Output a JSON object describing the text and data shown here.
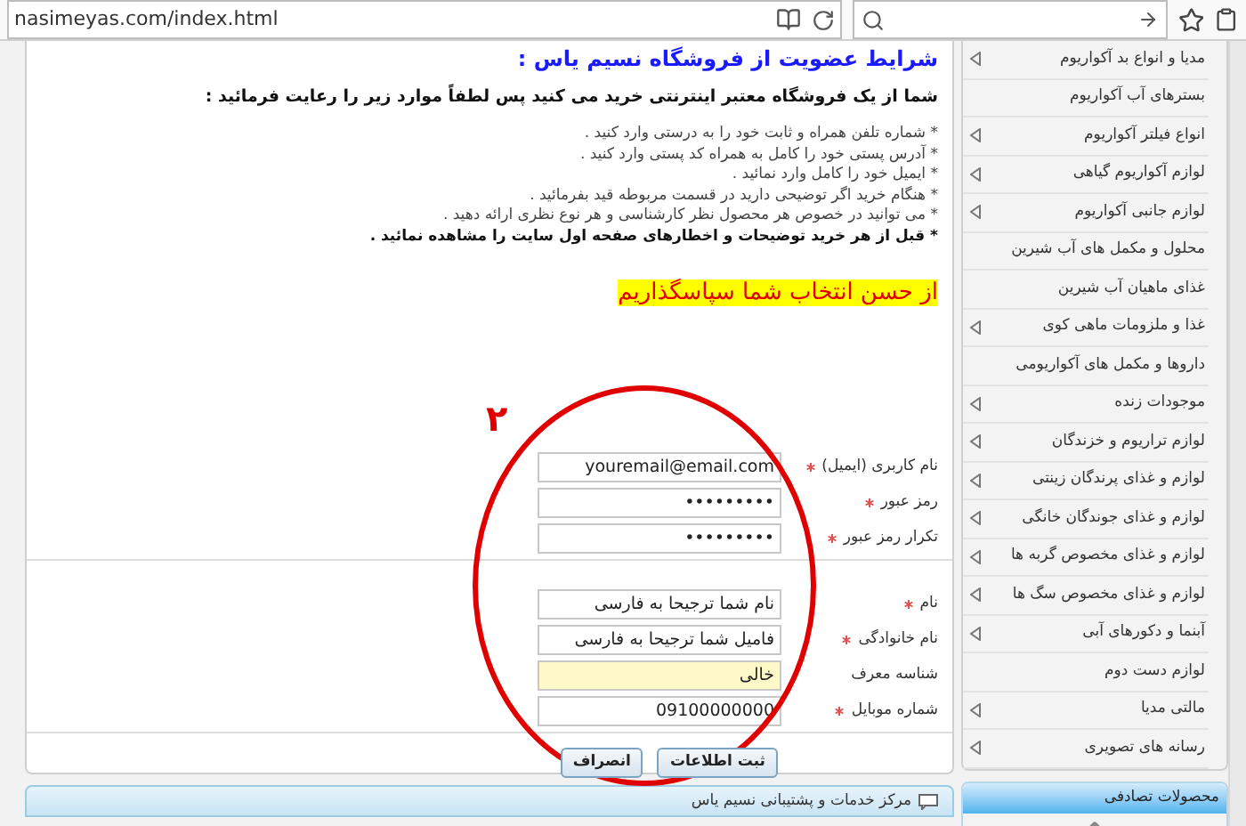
{
  "browser": {
    "url": "nasimeyas.com/index.html"
  },
  "terms": {
    "title": "شرایط عضویت از فروشگاه نسیم یاس :",
    "intro": "شما از یک فروشگاه معتبر اینترنتی خرید می کنید پس لطفاً موارد زیر را رعایت فرمائید :",
    "bullets": [
      {
        "text": "* شماره تلفن همراه و ثابت خود را به درستی وارد کنید .",
        "bold": false
      },
      {
        "text": "* آدرس پستی خود را کامل به همراه کد پستی وارد کنید .",
        "bold": false
      },
      {
        "text": "* ایمیل خود را کامل وارد نمائید .",
        "bold": false
      },
      {
        "text": "* هنگام خرید اگر توضیحی دارید در قسمت مربوطه قید بفرمائید .",
        "bold": false
      },
      {
        "text": "* می توانید در خصوص هر محصول نظر کارشناسی و هر نوع نظری ارائه دهید .",
        "bold": false
      },
      {
        "text": "* قبل از هر خرید توضیحات و اخطارهای صفحه اول سایت را مشاهده نمائید .",
        "bold": true
      }
    ],
    "thanks": "از حسن انتخاب شما سپاسگذاریم"
  },
  "annotation": {
    "marker": "۲"
  },
  "form_groups": [
    {
      "fields": [
        {
          "label": "نام کاربری (ایمیل)",
          "required": true,
          "value": "youremail@email.com",
          "highlighted": false
        },
        {
          "label": "رمز عبور",
          "required": true,
          "value": "•••••••••",
          "highlighted": false
        },
        {
          "label": "تکرار رمز عبور",
          "required": true,
          "value": "•••••••••",
          "highlighted": false
        }
      ]
    },
    {
      "fields": [
        {
          "label": "نام",
          "required": true,
          "value": "نام شما ترجیحا به فارسی",
          "highlighted": false
        },
        {
          "label": "نام خانوادگی",
          "required": true,
          "value": "فامیل شما ترجیحا به فارسی",
          "highlighted": false
        },
        {
          "label": "شناسه معرف",
          "required": false,
          "value": "خالی",
          "highlighted": true
        },
        {
          "label": "شماره موبایل",
          "required": true,
          "value": "09100000000",
          "highlighted": false
        }
      ]
    }
  ],
  "buttons": [
    "ثبت اطلاعات",
    "انصراف"
  ],
  "support_bar": {
    "title": "مرکز خدمات و پشتیبانی نسیم یاس"
  },
  "sidebar": {
    "items": [
      {
        "label": "مدیا و انواع بد آکواریوم",
        "has_submenu": true
      },
      {
        "label": "بسترهای آب آکواریوم",
        "has_submenu": false
      },
      {
        "label": "انواع فیلتر آکواریوم",
        "has_submenu": true
      },
      {
        "label": "لوازم آکواریوم گیاهی",
        "has_submenu": true
      },
      {
        "label": "لوازم جانبی آکواریوم",
        "has_submenu": true
      },
      {
        "label": "محلول و مکمل های آب شیرین",
        "has_submenu": false
      },
      {
        "label": "غذای ماهیان آب شیرین",
        "has_submenu": false
      },
      {
        "label": "غذا و ملزومات ماهی کوی",
        "has_submenu": true
      },
      {
        "label": "داروها و مکمل های آکواریومی",
        "has_submenu": false
      },
      {
        "label": "موجودات زنده",
        "has_submenu": true
      },
      {
        "label": "لوازم تراریوم و خزندگان",
        "has_submenu": true
      },
      {
        "label": "لوازم و غذای پرندگان زینتی",
        "has_submenu": true
      },
      {
        "label": "لوازم و غذای جوندگان خانگی",
        "has_submenu": true
      },
      {
        "label": "لوازم و غذای مخصوص گربه ها",
        "has_submenu": true
      },
      {
        "label": "لوازم و غذای مخصوص سگ ها",
        "has_submenu": true
      },
      {
        "label": "آبنما و دکورهای آبی",
        "has_submenu": true
      },
      {
        "label": "لوازم دست دوم",
        "has_submenu": false
      },
      {
        "label": "مالتی مدیا",
        "has_submenu": true
      },
      {
        "label": "رسانه های تصویری",
        "has_submenu": true
      }
    ]
  },
  "random_products": {
    "title": "محصولات تصادفی"
  }
}
